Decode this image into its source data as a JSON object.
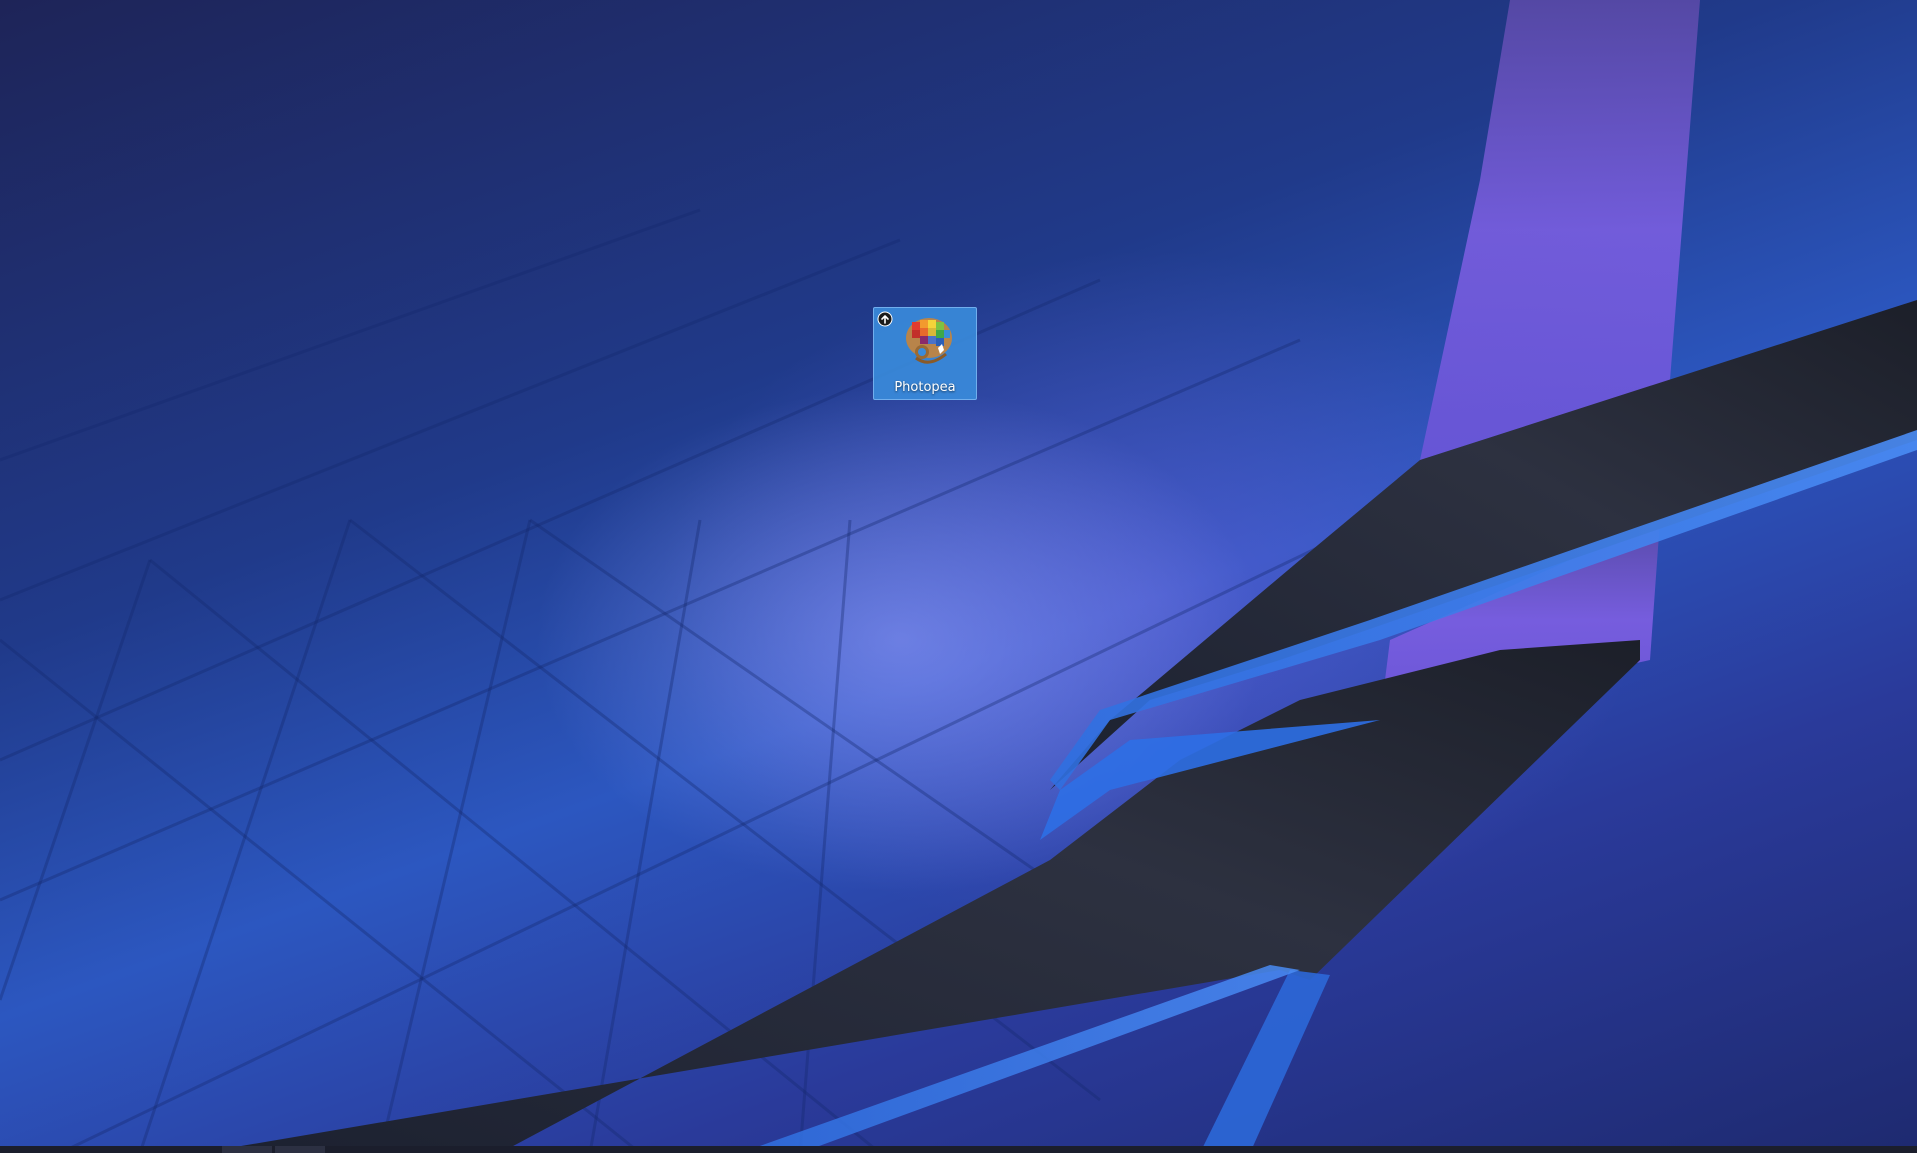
{
  "desktop": {
    "icons": [
      {
        "label": "Photopea",
        "icon": "photopea-palette-icon",
        "badge": "shortcut-arrow-icon",
        "selected": true
      }
    ]
  },
  "colors": {
    "selection": "#3a8cdc",
    "wallpaper_base": "#203a8a",
    "ribbon_dark": "#23262f",
    "ribbon_purple": "#7a5ee0"
  },
  "taskbar": {
    "visible": true
  }
}
